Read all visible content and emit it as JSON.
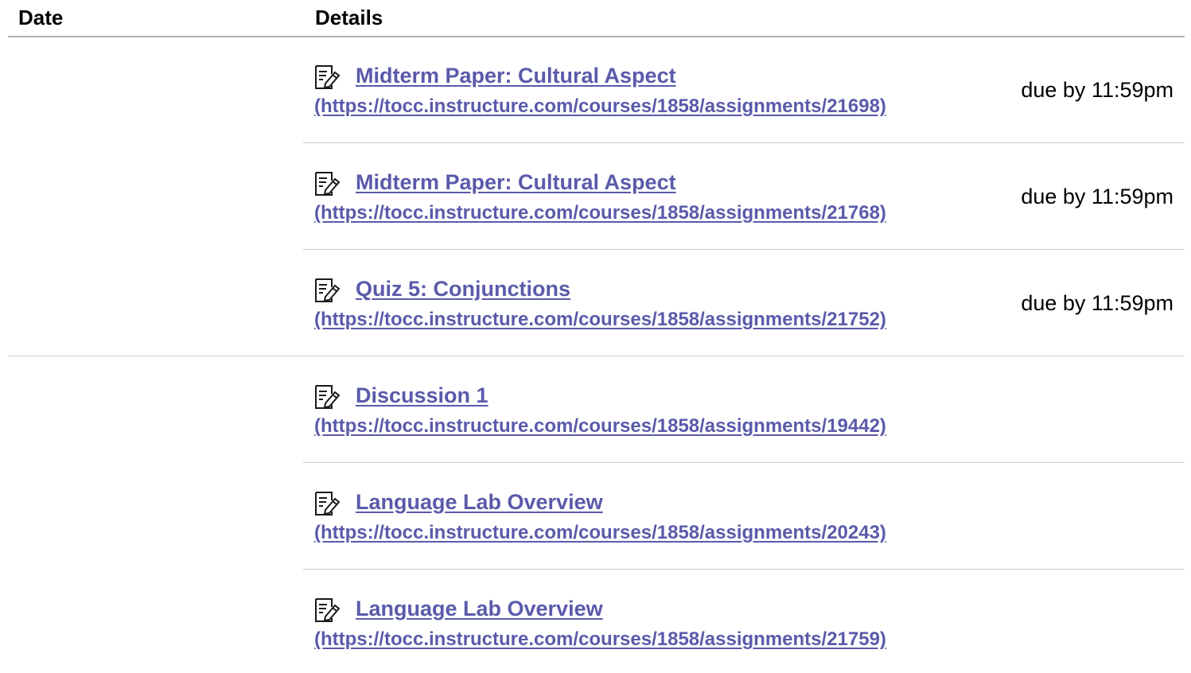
{
  "header": {
    "date_label": "Date",
    "details_label": "Details"
  },
  "groups": [
    {
      "items": [
        {
          "icon": "assignment-icon",
          "title": "Midterm Paper: Cultural Aspect",
          "url": "(https://tocc.instructure.com/courses/1858/assignments/21698)",
          "due": "due by 11:59pm"
        },
        {
          "icon": "assignment-icon",
          "title": "Midterm Paper: Cultural Aspect",
          "url": "(https://tocc.instructure.com/courses/1858/assignments/21768)",
          "due": "due by 11:59pm"
        },
        {
          "icon": "assignment-icon",
          "title": "Quiz 5: Conjunctions",
          "url": "(https://tocc.instructure.com/courses/1858/assignments/21752)",
          "due": "due by 11:59pm"
        }
      ]
    },
    {
      "items": [
        {
          "icon": "assignment-icon",
          "title": "Discussion 1",
          "url": "(https://tocc.instructure.com/courses/1858/assignments/19442)",
          "due": ""
        },
        {
          "icon": "assignment-icon",
          "title": "Language Lab Overview",
          "url": "(https://tocc.instructure.com/courses/1858/assignments/20243)",
          "due": ""
        },
        {
          "icon": "assignment-icon",
          "title": "Language Lab Overview",
          "url": "(https://tocc.instructure.com/courses/1858/assignments/21759)",
          "due": ""
        }
      ]
    }
  ],
  "colors": {
    "link": "#5a5aab",
    "divider": "#c7cdd1",
    "header_rule": "#a9b1bb"
  }
}
